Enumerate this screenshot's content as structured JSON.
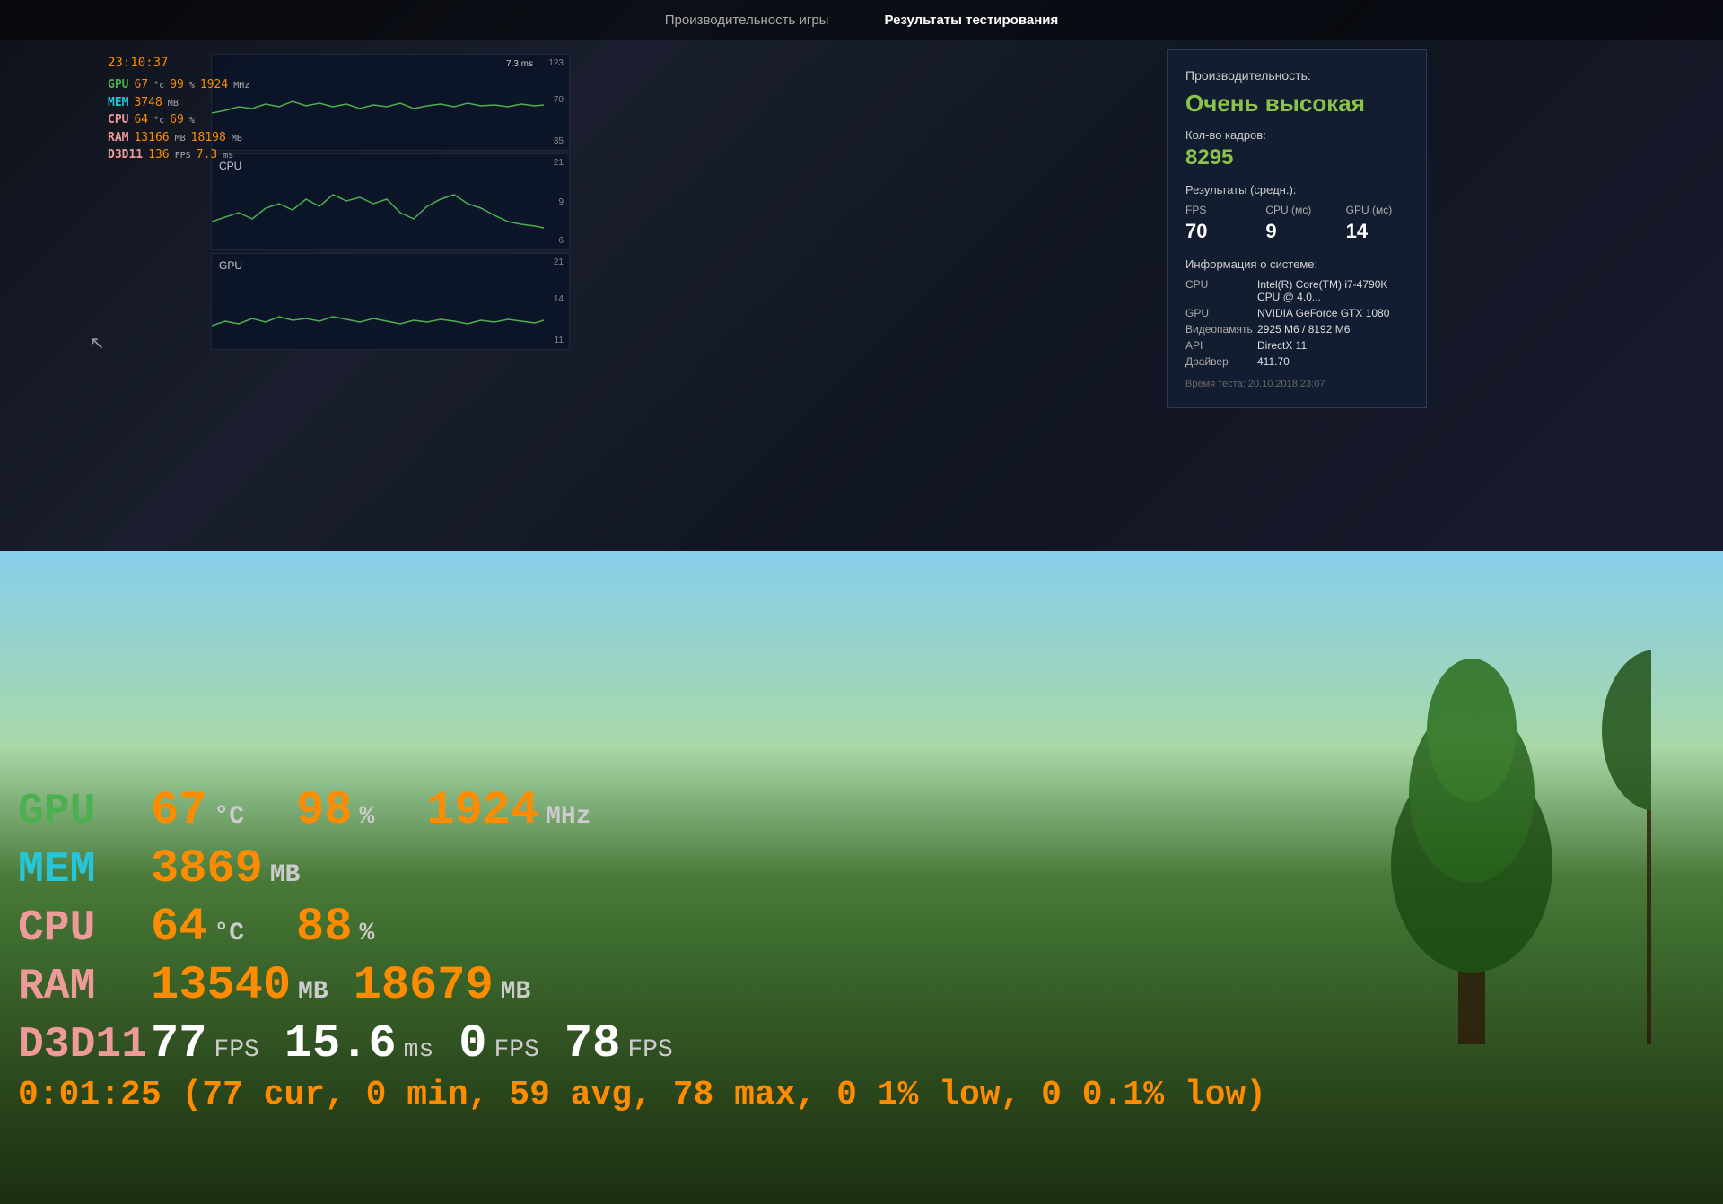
{
  "nav": {
    "tab1": "Производительность игры",
    "tab2": "Результаты тестирования"
  },
  "hud": {
    "time": "23:10:37",
    "gpu_label": "GPU",
    "gpu_temp": "67",
    "gpu_temp_unit": "°C",
    "gpu_pct": "99",
    "gpu_pct_unit": "%",
    "gpu_mhz": "1924",
    "gpu_mhz_unit": "MHz",
    "mem_label": "MEM",
    "mem_val": "3748",
    "mem_unit": "MB",
    "cpu_label": "CPU",
    "cpu_temp": "64",
    "cpu_temp_unit": "°C",
    "cpu_pct": "69",
    "cpu_pct_unit": "%",
    "ram_label": "RAM",
    "ram_val1": "13166",
    "ram_unit1": "MB",
    "ram_val2": "18198",
    "ram_unit2": "MB",
    "d3d_label": "D3D11",
    "d3d_fps": "136",
    "d3d_fps_unit": "FPS",
    "d3d_ms": "7.3",
    "d3d_ms_unit": "ms"
  },
  "charts": {
    "fps_top": "123",
    "fps_mid": "70",
    "fps_bot": "35",
    "cpu_top": "21",
    "cpu_mid": "9",
    "cpu_bot": "6",
    "cpu_label": "CPU",
    "gpu_top": "21",
    "gpu_mid": "14",
    "gpu_bot": "11",
    "gpu_label": "GPU",
    "time_label": "7.3 ms"
  },
  "results": {
    "perf_label": "Производительность:",
    "quality": "Очень высокая",
    "frames_label": "Кол-во кадров:",
    "frames_val": "8295",
    "avg_label": "Результаты (средн.):",
    "fps_header": "FPS",
    "fps_val": "70",
    "cpu_header": "CPU (мс)",
    "cpu_val": "9",
    "gpu_header": "GPU (мс)",
    "gpu_val": "14",
    "sysinfo_label": "Информация о системе:",
    "cpu_key": "CPU",
    "cpu_sysval": "Intel(R) Core(TM) i7-4790K CPU @ 4.0...",
    "gpu_key": "GPU",
    "gpu_sysval": "NVIDIA GeForce GTX 1080",
    "vram_key": "Видеопамять",
    "vram_val": "2925 М6 / 8192 М6",
    "api_key": "API",
    "api_val": "DirectX 11",
    "driver_key": "Драйвер",
    "driver_val": "411.70",
    "timestamp": "Время теста: 20.10.2018 23:07"
  },
  "big_hud": {
    "gpu_label": "GPU",
    "gpu_temp": "67",
    "gpu_temp_unit": "°C",
    "gpu_pct": "98",
    "gpu_pct_unit": "%",
    "gpu_mhz": "1924",
    "gpu_mhz_unit": "MHz",
    "mem_label": "MEM",
    "mem_val": "3869",
    "mem_unit": "MB",
    "cpu_label": "CPU",
    "cpu_temp": "64",
    "cpu_temp_unit": "°C",
    "cpu_pct": "88",
    "cpu_pct_unit": "%",
    "ram_label": "RAM",
    "ram_val1": "13540",
    "ram_unit1": "MB",
    "ram_val2": "18679",
    "ram_unit2": "MB",
    "d3d_label": "D3D11",
    "d3d_fps": "77",
    "d3d_fps_unit": "FPS",
    "d3d_ms": "15.6",
    "d3d_ms_unit": "ms",
    "d3d_extra1": "0",
    "d3d_extra1_unit": "FPS",
    "d3d_extra2": "78",
    "d3d_extra2_unit": "FPS",
    "timer": "0:01:25 (77 cur, 0 min, 59 avg, 78 max, 0 1% low, 0 0.1% low)"
  }
}
